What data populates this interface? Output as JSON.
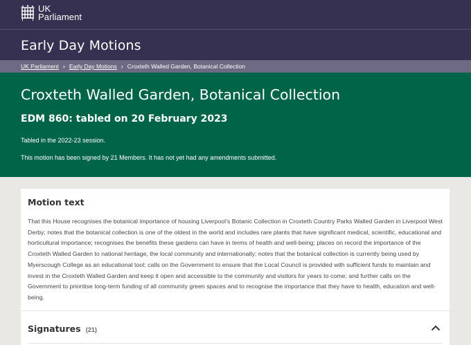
{
  "header": {
    "logo_line1": "UK",
    "logo_line2": "Parliament",
    "section_title": "Early Day Motions"
  },
  "breadcrumb": {
    "items": [
      {
        "label": "UK Parliament"
      },
      {
        "label": "Early Day Motions"
      },
      {
        "label": "Croxteth Walled Garden, Botanical Collection"
      }
    ]
  },
  "motion": {
    "title": "Croxteth Walled Garden, Botanical Collection",
    "edm_line": "EDM 860: tabled on 20 February 2023",
    "session": "Tabled in the 2022-23 session.",
    "signed": "This motion has been signed by 21 Members. It has not yet had any amendments submitted."
  },
  "motion_text": {
    "heading": "Motion text",
    "body": "That this House recognises the botanical importance of housing Liverpool’s Botanic Collection in Croxteth Country Parks Walled Garden in Liverpool West Derby; notes that the botanical collection is one of the oldest in the world and includes rare plants that have significant medical, scientific, educational and horticultural importance; recognises the benefits these gardens can have in terms of health and well-being; places on record the importance of the Croxteth Walled Garden to national heritage, the local community and internationally; notes that the botanical collection is currently being used by Myerscough College as an educational tool; calls on the Government to ensure that the Local Council is provided with sufficient funds to maintain and invest in the Croxteth Walled Garden and keep it open and accessible to the community and visitors for years to come; and further calls on the Government to prioritise long-term funding of all community green spaces and to recognise the importance that they have to health, education and well-being."
  },
  "signatures": {
    "heading": "Signatures",
    "count": "(21)"
  },
  "colors": {
    "header_bg": "#373151",
    "breadcrumb_bg": "#6f6a83",
    "hero_bg": "#006548",
    "page_bg": "#e9e8e5"
  },
  "icons": {
    "logo": "portcullis-icon",
    "breadcrumb_sep": "chevron-right-icon",
    "signatures_toggle": "chevron-up-icon"
  }
}
